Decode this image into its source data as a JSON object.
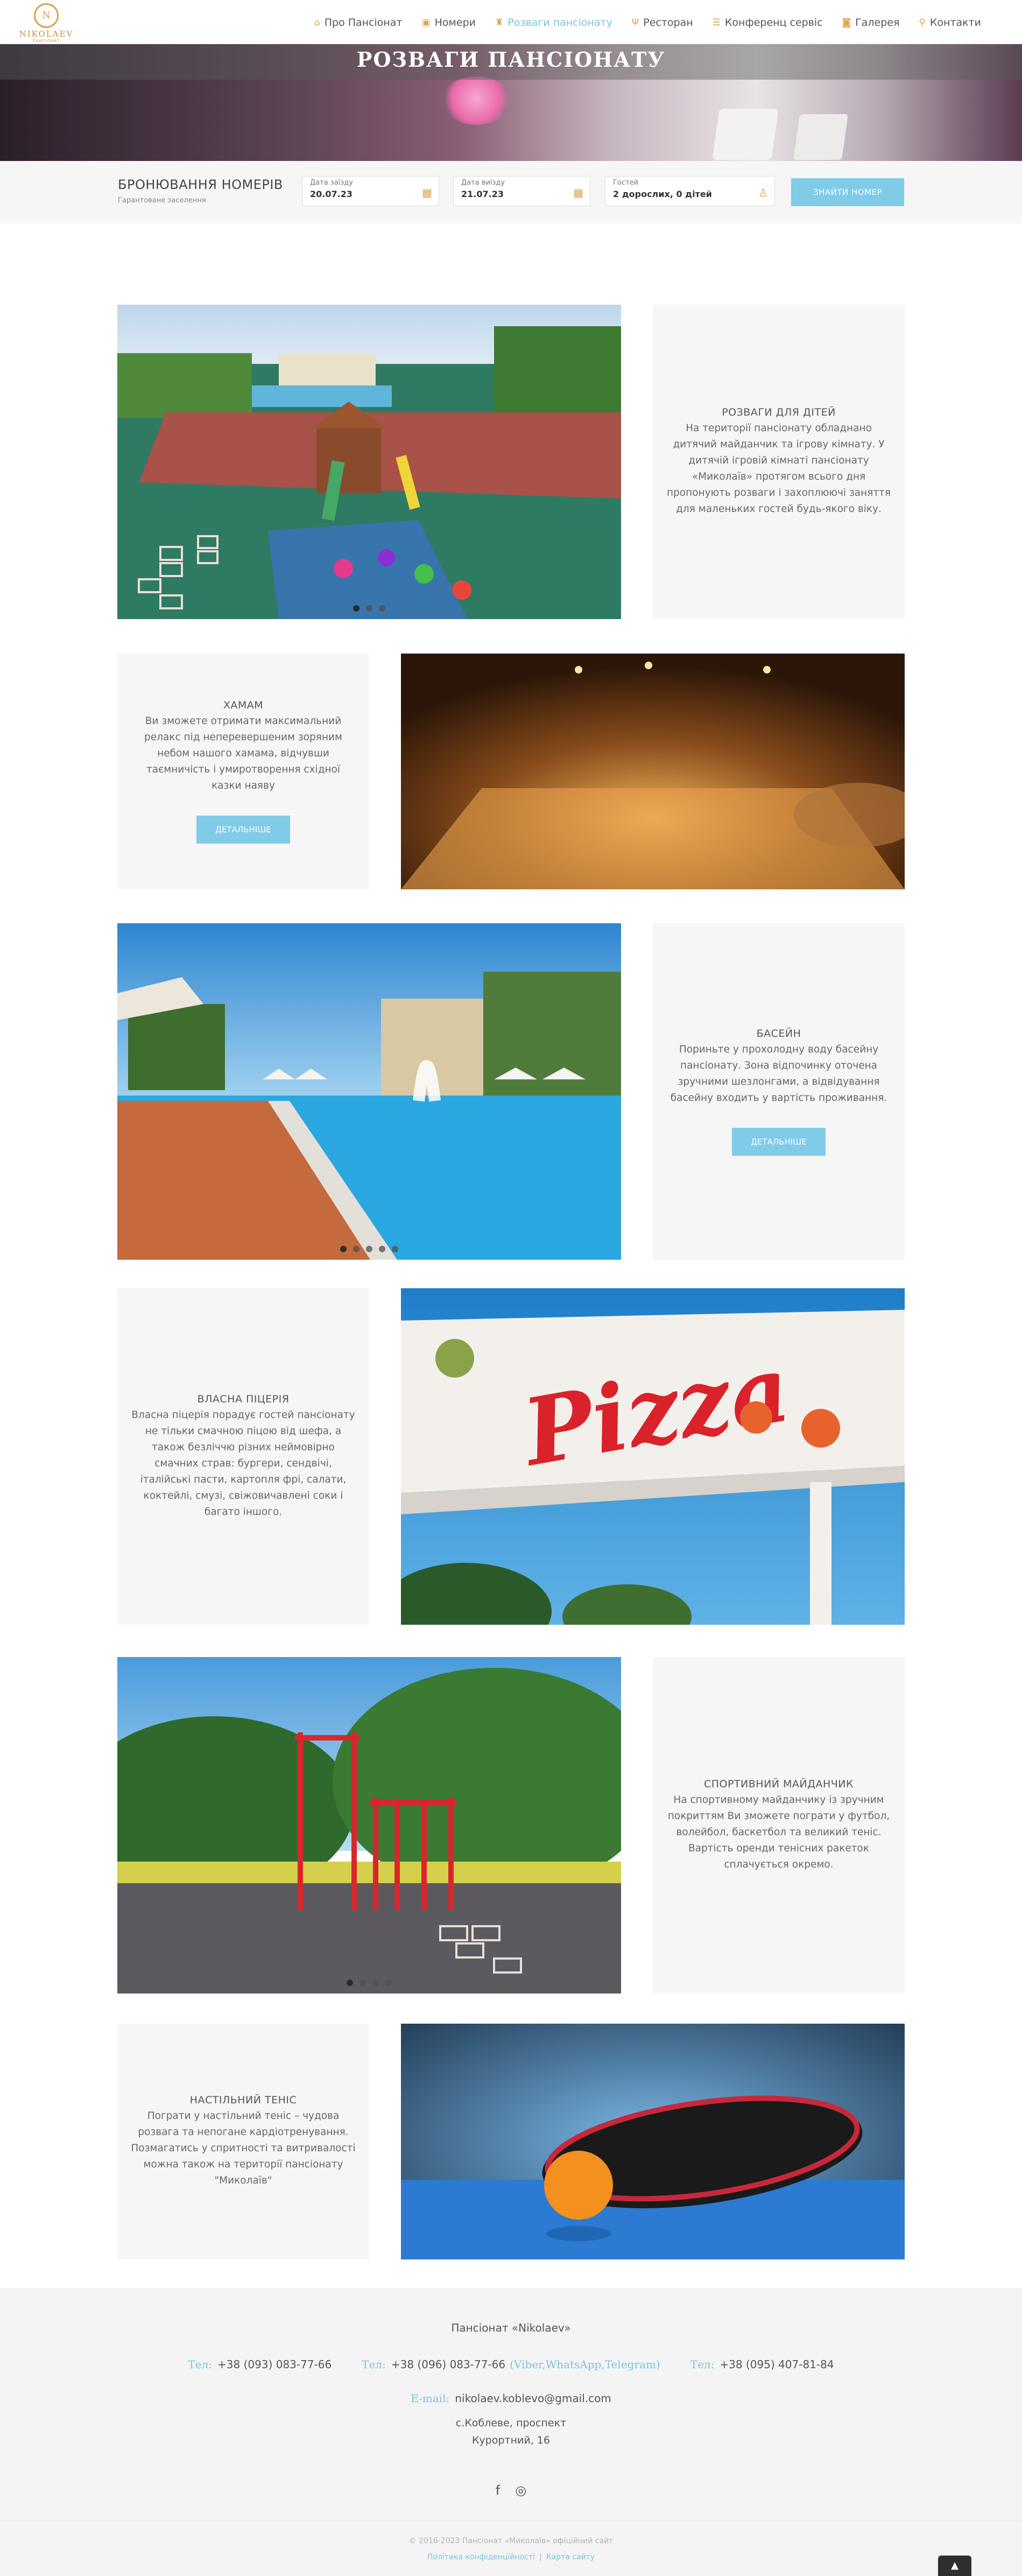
{
  "brand": {
    "mark": "N",
    "name": "NIKOLAEV",
    "sub": "ПАНСІОНАТ"
  },
  "nav": [
    {
      "label": "Про Пансіонат",
      "icon": "home-icon",
      "glyph": "⌂"
    },
    {
      "label": "Номери",
      "icon": "lock-icon",
      "glyph": "▣"
    },
    {
      "label": "Розваги пансіонату",
      "icon": "trophy-icon",
      "glyph": "♜"
    },
    {
      "label": "Ресторан",
      "icon": "fork-knife-icon",
      "glyph": "Ψ"
    },
    {
      "label": "Конференц сервіс",
      "icon": "comments-icon",
      "glyph": "☰"
    },
    {
      "label": "Галерея",
      "icon": "camera-icon",
      "glyph": "◙"
    },
    {
      "label": "Контакти",
      "icon": "map-marker-icon",
      "glyph": "⚲"
    }
  ],
  "hero": {
    "title": "РОЗВАГИ ПАНСІОНАТУ"
  },
  "booking": {
    "title": "БРОНЮВАННЯ НОМЕРІВ",
    "subtitle": "Гарантоване заселення",
    "checkin_label": "Дата заїзду",
    "checkin_value": "20.07.23",
    "checkout_label": "Дата виїзду",
    "checkout_value": "21.07.23",
    "guests_label": "Гостей",
    "guests_value": "2 дорослих, 0 дітей",
    "button": "ЗНАЙТИ НОМЕР"
  },
  "sections": [
    {
      "title": "РОЗВАГИ ДЛЯ ДІТЕЙ",
      "text": "На території пансіонату обладнано дитячий майданчик та ігрову кімнату. У дитячій ігровій кімнаті пансіонату «Миколаїв» протягом всього дня пропонують розваги і захоплюючі заняття для маленьких гостей будь-якого віку."
    },
    {
      "title": "ХАМАМ",
      "text": "Ви зможете отримати максимальний релакс під неперевершеним зоряним небом нашого хамама, відчувши таємничість і умиротворення східної казки наяву",
      "button": "ДЕТАЛЬНІШЕ"
    },
    {
      "title": "БАСЕЙН",
      "text": "Пориньте у прохолодну воду басейну пансіонату. Зона відпочинку оточена зручними шезлонгами, а відвідування басейну входить у вартість проживання.",
      "button": "ДЕТАЛЬНІШЕ"
    },
    {
      "title": "ВЛАСНА ПІЦЕРІЯ",
      "text": "Власна піцерія порадує гостей пансіонату не тільки смачною піцою від шефа, а також безліччю різних неймовірно смачних страв: бургери, сендвічі, італійські пасти, картопля фрі, салати, коктейлі, смузі, свіжовичавлені соки і багато іншого."
    },
    {
      "title": "СПОРТИВНИЙ МАЙДАНЧИК",
      "text": "На  спортивному майданчику із зручним покриттям Ви зможете пограти у футбол, волейбол, баскетбол та великий тенiс. Вартість оренди тенісних ракеток сплачується окремо."
    },
    {
      "title": "НАСТІЛЬНИЙ ТЕНІС",
      "text": "Пограти у настільний теніс – чудова розвага та непогане кардіотренування. Позмагатись у спритності та витривалості можна також на території пансіонату \"Миколаїв\""
    }
  ],
  "images": {
    "pizza_sign": "Pizza"
  },
  "footer": {
    "company": "Пансіонат «Nikolaev»",
    "phone_label": "Тел:",
    "phones": [
      "+38 (093) 083-77-66",
      "+38 (096) 083-77-66",
      "+38 (095) 407-81-84"
    ],
    "phone_note": "(Viber,WhatsApp,Telegram)",
    "email_label": "E-mail:",
    "email": "nikolaev.koblevo@gmail.com",
    "address_line1": "с.Коблеве, проспект",
    "address_line2": "Курортний, 16",
    "social": [
      {
        "name": "facebook-icon",
        "glyph": "f"
      },
      {
        "name": "instagram-icon",
        "glyph": "◎"
      }
    ],
    "copyright": "© 2016-2023 Пансіонат «Миколаїв» офіційний сайт",
    "privacy": "Політика конфіденційності",
    "sitemap": "Карта сайту",
    "to_top": "▲"
  }
}
